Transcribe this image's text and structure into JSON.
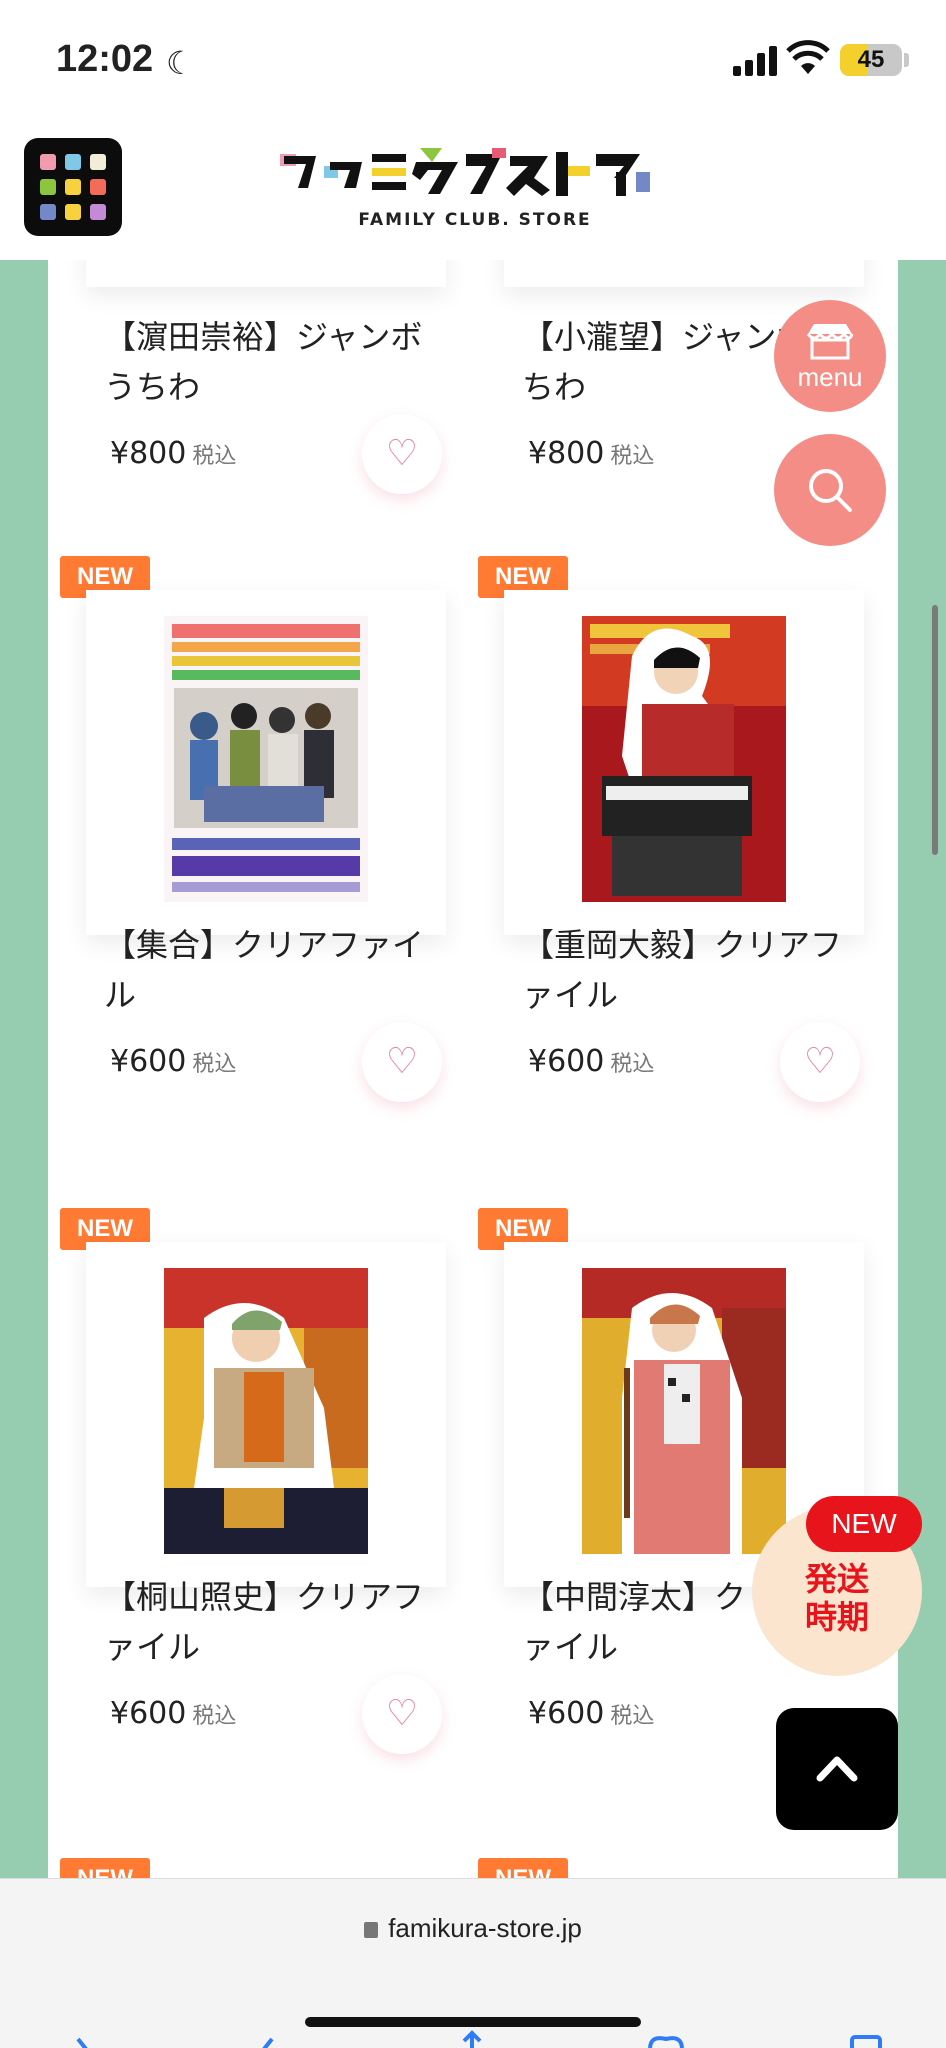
{
  "status_bar": {
    "time": "12:02",
    "battery": "45",
    "battery_level": 0.45
  },
  "header": {
    "logo_sub": "FAMILY CLUB. STORE"
  },
  "products": [
    {
      "name": "【濵田崇裕】ジャンボうちわ",
      "price": "¥800",
      "tax": "税込",
      "badge": ""
    },
    {
      "name": "【小瀧望】ジャンボうちわ",
      "price": "¥800",
      "tax": "税込",
      "badge": ""
    },
    {
      "name": "【集合】クリアファイル",
      "price": "¥600",
      "tax": "税込",
      "badge": "NEW"
    },
    {
      "name": "【重岡大毅】クリアファイル",
      "price": "¥600",
      "tax": "税込",
      "badge": "NEW"
    },
    {
      "name": "【桐山照史】クリアファイル",
      "price": "¥600",
      "tax": "税込",
      "badge": "NEW"
    },
    {
      "name": "【中間淳太】クリアファイル",
      "price": "¥600",
      "tax": "税込",
      "badge": "NEW"
    },
    {
      "badge": "NEW"
    },
    {
      "badge": "NEW"
    }
  ],
  "float": {
    "menu_label": "menu",
    "ship_new": "NEW",
    "ship_line1": "発送",
    "ship_line2": "時期"
  },
  "browser": {
    "url": "famikura-store.jp"
  },
  "colors": {
    "side": "#96cdb1",
    "badge": "#ff7a33",
    "float_pink": "#f48d86",
    "heart": "#e9849c"
  }
}
